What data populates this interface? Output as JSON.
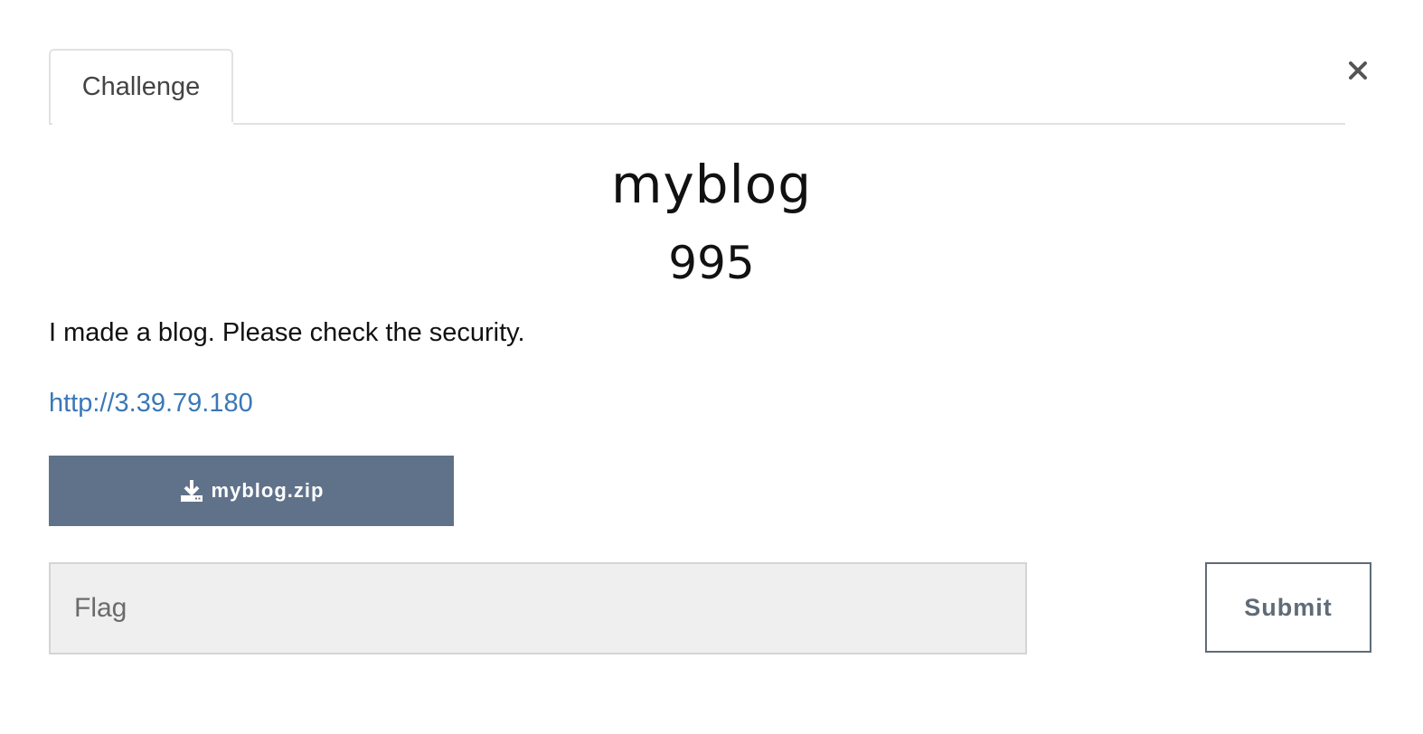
{
  "tabs": [
    {
      "label": "Challenge"
    }
  ],
  "close_icon": "close-icon",
  "challenge": {
    "name": "myblog",
    "points": "995",
    "description": "I made a blog. Please check the security.",
    "link": "http://3.39.79.180",
    "file": {
      "label": "myblog.zip",
      "icon": "download-icon"
    }
  },
  "flag_form": {
    "placeholder": "Flag",
    "value": "",
    "submit_label": "Submit"
  },
  "colors": {
    "download_button": "#5f7289",
    "link": "#3a78b7",
    "input_bg": "#efefef"
  }
}
